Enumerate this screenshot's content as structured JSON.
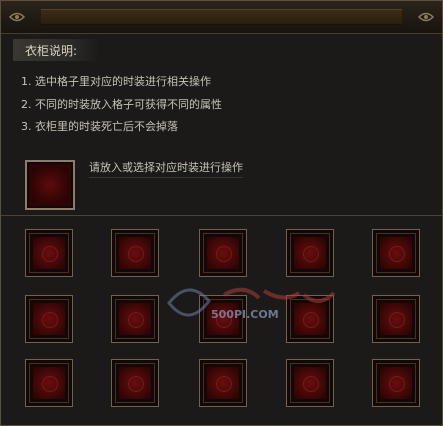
{
  "header": {
    "title": "衣柜说明:"
  },
  "instructions": [
    "1. 选中格子里对应的时装进行相关操作",
    "2. 不同的时装放入格子可获得不同的属性",
    "3. 衣柜里的时装死亡后不会掉落"
  ],
  "prompt": {
    "text": "请放入或选择对应时装进行操作"
  },
  "watermark": {
    "text": "500PI.COM"
  },
  "grid": {
    "rows": 3,
    "cols": 5
  },
  "colors": {
    "frame": "#6e6251",
    "slot_red": "#5c0c0c",
    "background": "#1b1a19",
    "text": "#c8c2b7"
  }
}
